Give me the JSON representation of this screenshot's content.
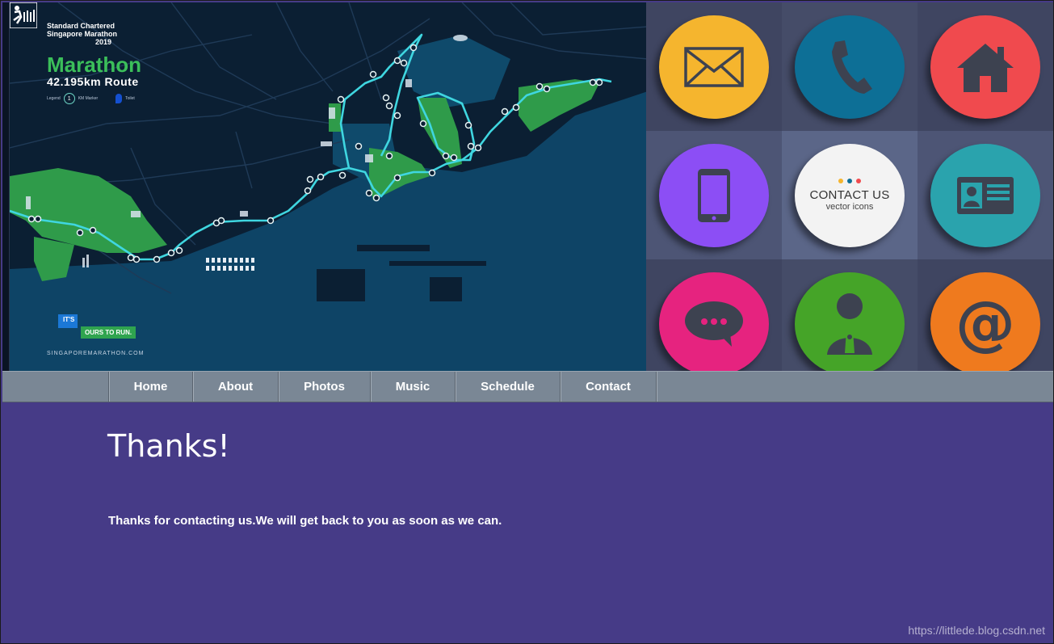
{
  "banner": {
    "map": {
      "brand_line1": "Standard Chartered",
      "brand_line2": "Singapore Marathon",
      "brand_line3": "2019",
      "title": "Marathon",
      "subtitle": "42.195km Route",
      "legend_label": "Legend",
      "legend_marker_number": "1",
      "legend_marker_text": "KM Marker",
      "legend_pin_text": "Toilet",
      "slogan_line1": "IT'S",
      "slogan_line2": "OURS TO RUN.",
      "site": "SINGAPOREMARATHON.COM"
    },
    "icon_tiles": [
      {
        "icon": "mail-icon",
        "circle_color": "#f5b52e",
        "tile_bg": "#3f4561"
      },
      {
        "icon": "phone-icon",
        "circle_color": "#0d6f96",
        "tile_bg": "#454c68"
      },
      {
        "icon": "home-icon",
        "circle_color": "#f04a4e",
        "tile_bg": "#3f4561"
      },
      {
        "icon": "smartphone-icon",
        "circle_color": "#8c4ef5",
        "tile_bg": "#4d5575"
      },
      {
        "icon": "contact-us-badge",
        "circle_color": "#f3f3f3",
        "tile_bg": "#5b6688",
        "title": "CONTACT US",
        "subtitle": "vector icons"
      },
      {
        "icon": "id-card-icon",
        "circle_color": "#2aa3ad",
        "tile_bg": "#4d5575"
      },
      {
        "icon": "chat-bubble-icon",
        "circle_color": "#e6237f",
        "tile_bg": "#3f4561"
      },
      {
        "icon": "user-icon",
        "circle_color": "#45a428",
        "tile_bg": "#454c68"
      },
      {
        "icon": "at-sign-icon",
        "circle_color": "#ef7a1e",
        "tile_bg": "#3f4561"
      }
    ]
  },
  "nav": {
    "items": [
      {
        "label": "Home"
      },
      {
        "label": "About"
      },
      {
        "label": "Photos"
      },
      {
        "label": "Music"
      },
      {
        "label": "Schedule"
      },
      {
        "label": "Contact"
      }
    ]
  },
  "content": {
    "heading": "Thanks!",
    "message": "Thanks for contacting us.We will get back to you as soon as we can."
  },
  "watermark": "https://littlede.blog.csdn.net",
  "colors": {
    "nav_bg": "#7a8795",
    "content_bg": "#463b87",
    "map_bg": "#0b1f33",
    "route": "#3fd6e0",
    "park_green": "#2f9b4a"
  }
}
